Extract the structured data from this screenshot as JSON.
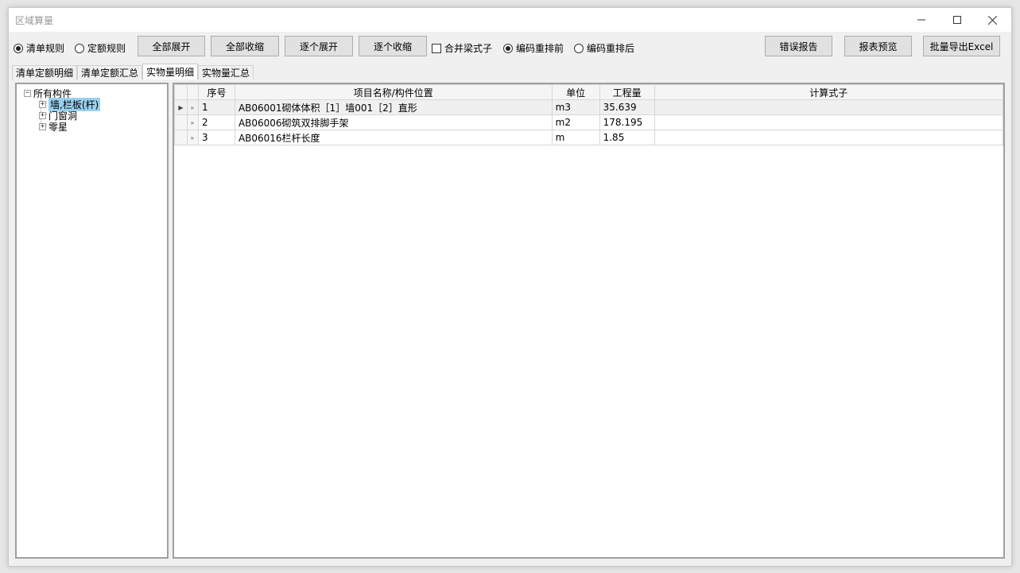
{
  "window": {
    "title": "区域算量",
    "minimize_icon": "minimize-icon",
    "maximize_icon": "maximize-icon",
    "close_icon": "close-icon"
  },
  "toolbar": {
    "rule_options": [
      {
        "label": "清单规则",
        "selected": true
      },
      {
        "label": "定额规则",
        "selected": false
      }
    ],
    "expand_all": "全部展开",
    "collapse_all": "全部收缩",
    "expand_each": "逐个展开",
    "collapse_each": "逐个收缩",
    "merge_beam": {
      "label": "合并梁式子",
      "checked": false
    },
    "order_options": [
      {
        "label": "编码重排前",
        "selected": true
      },
      {
        "label": "编码重排后",
        "selected": false
      }
    ],
    "error_report": "错误报告",
    "report_preview": "报表预览",
    "batch_export": "批量导出Excel"
  },
  "tabs": [
    {
      "label": "清单定额明细",
      "active": false
    },
    {
      "label": "清单定额汇总",
      "active": false
    },
    {
      "label": "实物量明细",
      "active": true
    },
    {
      "label": "实物量汇总",
      "active": false
    }
  ],
  "tree": {
    "root": "所有构件",
    "children": [
      {
        "label": "墙,栏板(杆)",
        "selected": true
      },
      {
        "label": "门窗洞",
        "selected": false
      },
      {
        "label": "零星",
        "selected": false
      }
    ]
  },
  "grid": {
    "columns": [
      "序号",
      "项目名称/构件位置",
      "单位",
      "工程量",
      "计算式子"
    ],
    "rows": [
      {
        "no": "1",
        "name": "AB06001砌体体积［1］墙001［2］直形",
        "unit": "m3",
        "qty": "35.639",
        "formula": ""
      },
      {
        "no": "2",
        "name": "AB06006砌筑双排脚手架",
        "unit": "m2",
        "qty": "178.195",
        "formula": ""
      },
      {
        "no": "3",
        "name": "AB06016栏杆长度",
        "unit": "m",
        "qty": "1.85",
        "formula": ""
      }
    ]
  }
}
